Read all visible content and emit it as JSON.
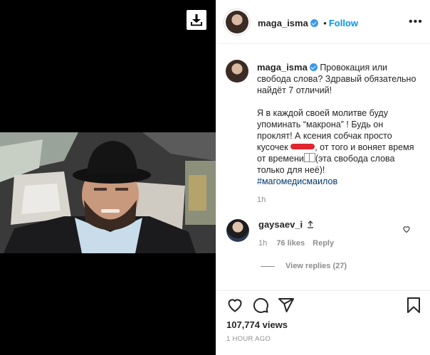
{
  "post": {
    "username": "maga_isma",
    "follow_label": "Follow",
    "separator": "•",
    "more_label": "•••"
  },
  "caption": {
    "username": "maga_isma",
    "text_1": "Провокация или свобода слова? Здравый обязательно найдёт 7 отличий!",
    "text_2a": "Я в каждой своей молитве буду упоминать “макрона” ! Будь он проклят! А ксения собчак просто кусочек ",
    "text_2b": ", от того и воняет время от времени",
    "text_2c": "(эта свобода слова только для неё)!",
    "hashtag": "#магомедисмаилов",
    "time": "1h"
  },
  "comment": {
    "username": "gaysaev_i",
    "time": "1h",
    "likes": "76 likes",
    "reply_label": "Reply",
    "view_replies": "View replies (27)"
  },
  "actions": {
    "views": "107,774 views",
    "time_ago": "1 HOUR AGO"
  },
  "colors": {
    "accent": "#0095f6",
    "verified": "#3897f0",
    "redaction": "#e0262f"
  }
}
